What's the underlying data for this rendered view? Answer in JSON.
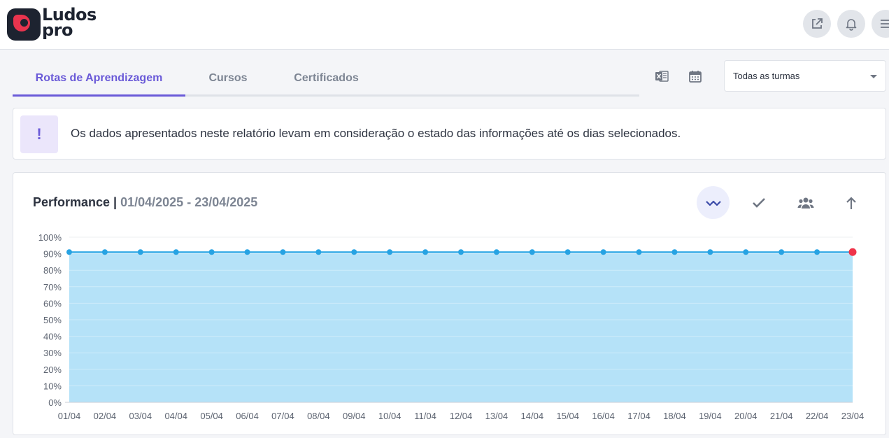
{
  "header": {
    "logo_text_line1": "Ludos",
    "logo_text_line2": "pro",
    "buttons": [
      "external-link-icon",
      "bell-icon",
      "menu-icon"
    ]
  },
  "tabs": [
    {
      "label": "Rotas de Aprendizagem",
      "active": true
    },
    {
      "label": "Cursos",
      "active": false
    },
    {
      "label": "Certificados",
      "active": false
    }
  ],
  "toolbar": {
    "icons": [
      "excel-export-icon",
      "calendar-icon"
    ],
    "class_filter": "Todas as turmas"
  },
  "notice": {
    "icon": "!",
    "text": "Os dados apresentados neste relatório levam em consideração o estado das informações até os dias selecionados."
  },
  "performance": {
    "title": "Performance |",
    "date_range": "01/04/2025 - 23/04/2025",
    "view_buttons": [
      {
        "icon": "trend-line-icon",
        "active": true
      },
      {
        "icon": "check-icon",
        "active": false
      },
      {
        "icon": "group-icon",
        "active": false
      },
      {
        "icon": "arrow-up-icon",
        "active": false
      }
    ]
  },
  "colors": {
    "accent": "#6a5ad8",
    "line": "#27a3e3",
    "area": "#b5e2f8",
    "last_point": "#ef3349"
  },
  "chart_data": {
    "type": "area",
    "x": [
      "01/04",
      "02/04",
      "03/04",
      "04/04",
      "05/04",
      "06/04",
      "07/04",
      "08/04",
      "09/04",
      "10/04",
      "11/04",
      "12/04",
      "13/04",
      "14/04",
      "15/04",
      "16/04",
      "17/04",
      "18/04",
      "19/04",
      "20/04",
      "21/04",
      "22/04",
      "23/04"
    ],
    "series": [
      {
        "values": [
          91,
          91,
          91,
          91,
          91,
          91,
          91,
          91,
          91,
          91,
          91,
          91,
          91,
          91,
          91,
          91,
          91,
          91,
          91,
          91,
          91,
          91,
          91
        ]
      }
    ],
    "y_ticks": [
      "0%",
      "10%",
      "20%",
      "30%",
      "40%",
      "50%",
      "60%",
      "70%",
      "80%",
      "90%",
      "100%"
    ],
    "ylim": [
      0,
      100
    ],
    "grid": true,
    "highlight_last_point": true
  }
}
